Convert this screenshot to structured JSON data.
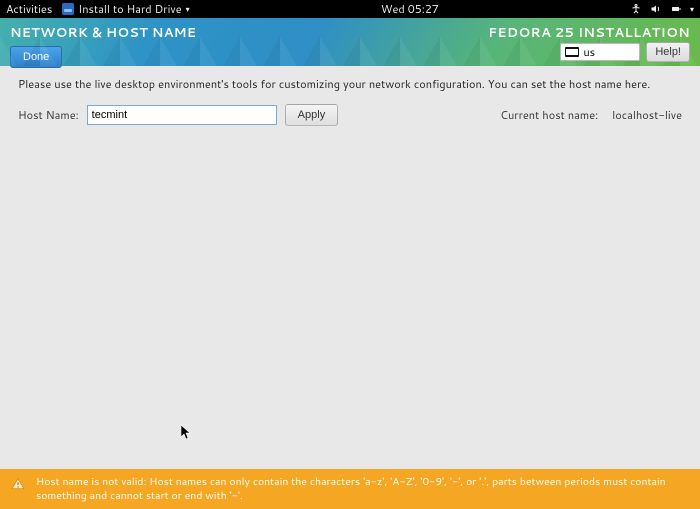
{
  "topbar": {
    "activities": "Activities",
    "app_label": "Install to Hard Drive",
    "clock": "Wed 05:27"
  },
  "header": {
    "title": "NETWORK & HOST NAME",
    "installer_brand": "FEDORA 25 INSTALLATION",
    "done_label": "Done",
    "help_label": "Help!",
    "kbd_layout": "us"
  },
  "main": {
    "info_text": "Please use the live desktop environment's tools for customizing your network configuration.  You can set the host name here.",
    "hostname_label": "Host Name:",
    "hostname_value": "tecmint",
    "apply_label": "Apply",
    "current_host_label": "Current host name:",
    "current_host_value": "localhost-live"
  },
  "warning": {
    "text": "Host name is not valid: Host names can only contain the characters 'a-z', 'A-Z', '0-9', '-', or '.', parts between periods must contain something and cannot start or end with '-'."
  }
}
